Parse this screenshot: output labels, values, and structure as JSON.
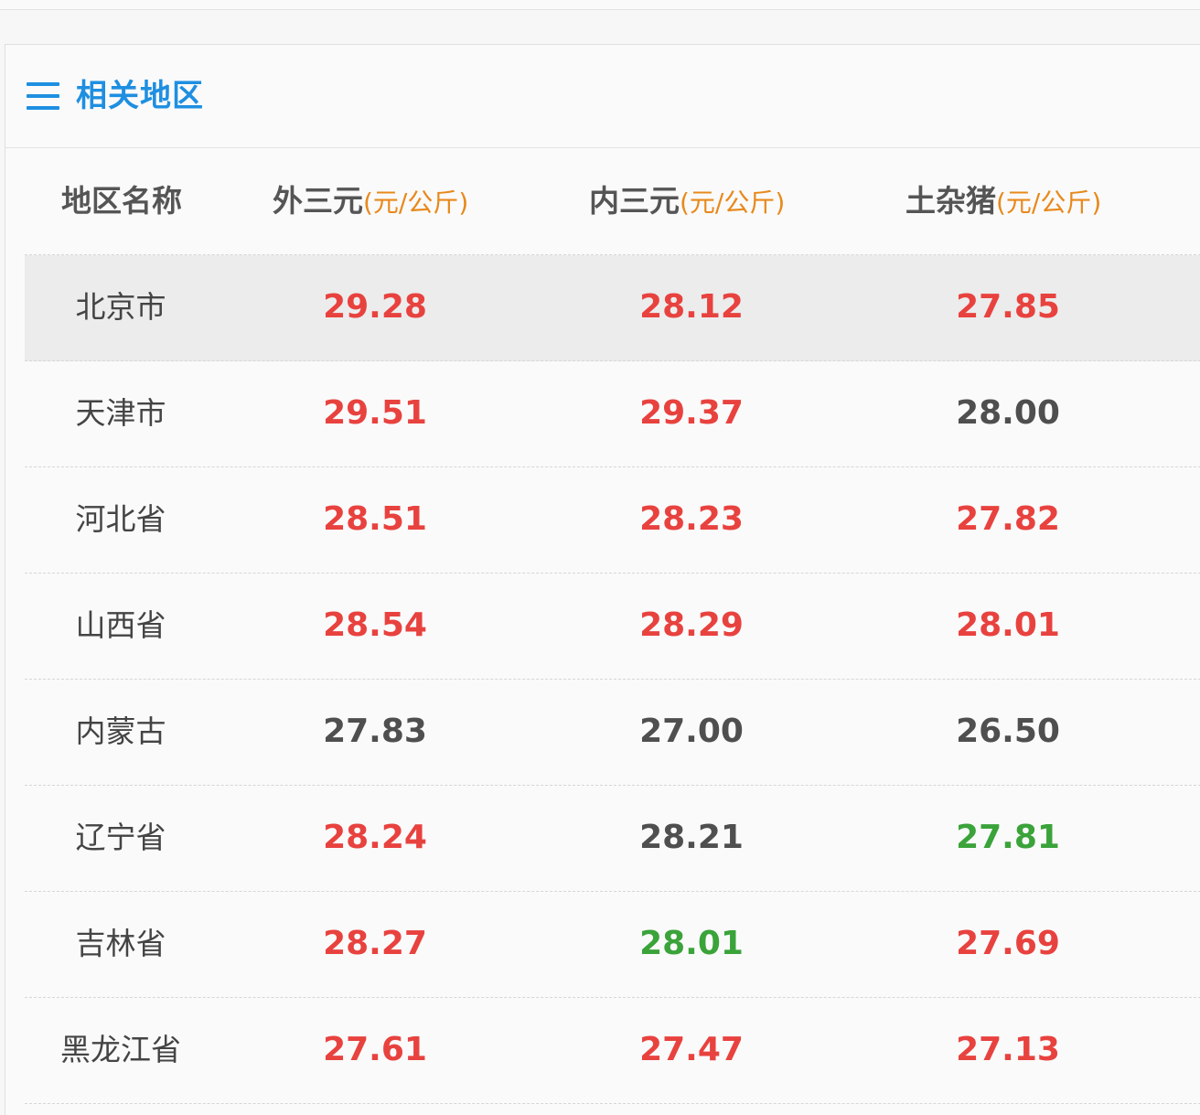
{
  "panel": {
    "title": "相关地区",
    "title_color": "#1e8fe1"
  },
  "table": {
    "headers": [
      {
        "label": "地区名称",
        "unit": ""
      },
      {
        "label": "外三元",
        "unit": "(元/公斤)"
      },
      {
        "label": "内三元",
        "unit": "(元/公斤)"
      },
      {
        "label": "土杂猪",
        "unit": "(元/公斤)"
      }
    ],
    "rows": [
      {
        "region": "北京市",
        "values": [
          {
            "v": "29.28",
            "trend": "up"
          },
          {
            "v": "28.12",
            "trend": "up"
          },
          {
            "v": "27.85",
            "trend": "up"
          }
        ]
      },
      {
        "region": "天津市",
        "values": [
          {
            "v": "29.51",
            "trend": "up"
          },
          {
            "v": "29.37",
            "trend": "up"
          },
          {
            "v": "28.00",
            "trend": "flat"
          }
        ]
      },
      {
        "region": "河北省",
        "values": [
          {
            "v": "28.51",
            "trend": "up"
          },
          {
            "v": "28.23",
            "trend": "up"
          },
          {
            "v": "27.82",
            "trend": "up"
          }
        ]
      },
      {
        "region": "山西省",
        "values": [
          {
            "v": "28.54",
            "trend": "up"
          },
          {
            "v": "28.29",
            "trend": "up"
          },
          {
            "v": "28.01",
            "trend": "up"
          }
        ]
      },
      {
        "region": "内蒙古",
        "values": [
          {
            "v": "27.83",
            "trend": "flat"
          },
          {
            "v": "27.00",
            "trend": "flat"
          },
          {
            "v": "26.50",
            "trend": "flat"
          }
        ]
      },
      {
        "region": "辽宁省",
        "values": [
          {
            "v": "28.24",
            "trend": "up"
          },
          {
            "v": "28.21",
            "trend": "flat"
          },
          {
            "v": "27.81",
            "trend": "down"
          }
        ]
      },
      {
        "region": "吉林省",
        "values": [
          {
            "v": "28.27",
            "trend": "up"
          },
          {
            "v": "28.01",
            "trend": "down"
          },
          {
            "v": "27.69",
            "trend": "up"
          }
        ]
      },
      {
        "region": "黑龙江省",
        "values": [
          {
            "v": "27.61",
            "trend": "up"
          },
          {
            "v": "27.47",
            "trend": "up"
          },
          {
            "v": "27.13",
            "trend": "up"
          }
        ]
      }
    ]
  },
  "colors": {
    "up": "#e8423f",
    "flat": "#4f4f4f",
    "down": "#3aa33a",
    "unit": "#e8891c"
  }
}
